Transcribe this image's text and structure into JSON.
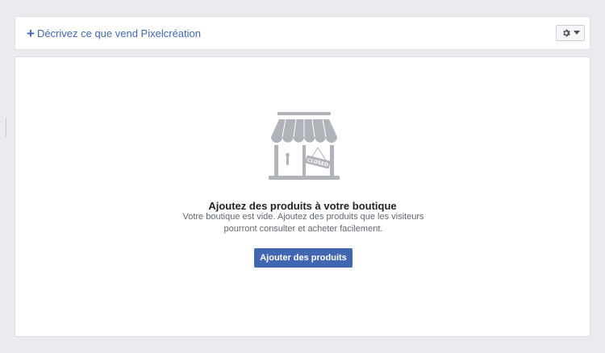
{
  "header": {
    "plus_glyph": "+",
    "describe_link": "Décrivez ce que vend Pixelcréation",
    "settings_icon": "gear-icon",
    "dropdown_icon": "caret-down-icon"
  },
  "empty_state": {
    "illustration": "closed-store-icon",
    "sign_text": "CLOSED",
    "title": "Ajoutez des produits à votre boutique",
    "description": "Votre boutique est vide. Ajoutez des produits que les visiteurs pourront consulter et acheter facilement.",
    "button_label": "Ajouter des produits"
  },
  "colors": {
    "accent": "#4267b2",
    "background": "#e9ebee",
    "illustration": "#b0b3b9"
  }
}
